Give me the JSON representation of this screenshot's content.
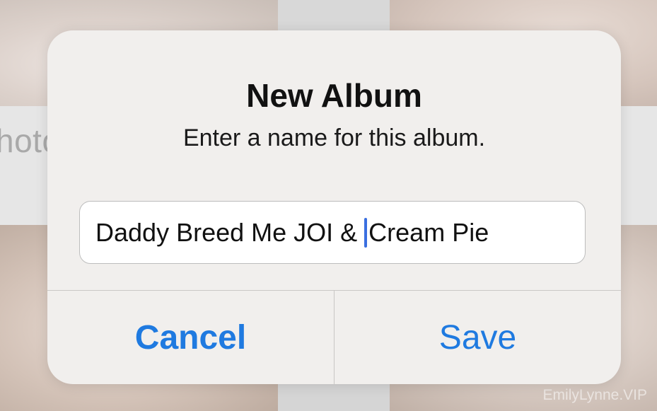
{
  "background": {
    "peek_text": "hoto",
    "watermark": "EmilyLynne.VIP"
  },
  "dialog": {
    "title": "New Album",
    "message": "Enter a name for this album.",
    "input": {
      "value_before_caret": "Daddy Breed Me JOI & ",
      "value_after_caret": "Cream Pie"
    },
    "buttons": {
      "cancel_label": "Cancel",
      "save_label": "Save"
    }
  },
  "colors": {
    "accent": "#1f7ae0",
    "caret": "#3a6fe0"
  }
}
